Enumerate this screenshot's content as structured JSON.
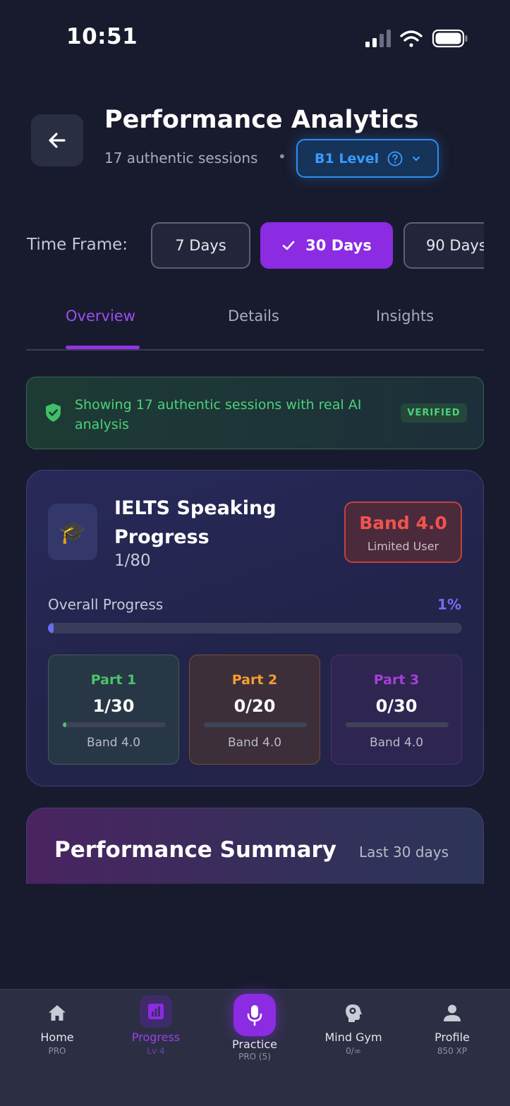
{
  "status_bar": {
    "time": "10:51"
  },
  "header": {
    "title": "Performance Analytics",
    "sessions": "17 authentic sessions",
    "separator": "•",
    "level": "B1 Level"
  },
  "time_frame": {
    "label": "Time Frame:",
    "options": [
      "7 Days",
      "30 Days",
      "90 Days"
    ],
    "selected": "30 Days"
  },
  "tabs": [
    "Overview",
    "Details",
    "Insights"
  ],
  "active_tab": "Overview",
  "verified_banner": {
    "text": "Showing 17 authentic sessions with real AI analysis",
    "badge": "VERIFIED"
  },
  "ielts": {
    "title": "IELTS Speaking Progress",
    "count": "1/80",
    "band": "Band 4.0",
    "band_desc": "Limited User",
    "overall_label": "Overall Progress",
    "overall_pct": "1%",
    "overall_fraction": 0.0125,
    "parts": [
      {
        "name": "Part 1",
        "score": "1/30",
        "band": "Band 4.0",
        "fraction": 0.0333,
        "color": "#4bc46a"
      },
      {
        "name": "Part 2",
        "score": "0/20",
        "band": "Band 4.0",
        "fraction": 0,
        "color": "#f59e2e"
      },
      {
        "name": "Part 3",
        "score": "0/30",
        "band": "Band 4.0",
        "fraction": 0,
        "color": "#a63fd8"
      }
    ]
  },
  "summary": {
    "title": "Performance Summary",
    "range": "Last 30 days"
  },
  "nav": [
    {
      "label": "Home",
      "sub": "PRO",
      "icon": "home-icon"
    },
    {
      "label": "Progress",
      "sub": "Lv 4",
      "icon": "chart-icon"
    },
    {
      "label": "Practice",
      "sub": "PRO (5)",
      "icon": "microphone-icon"
    },
    {
      "label": "Mind Gym",
      "sub": "0/∞",
      "icon": "brain-icon"
    },
    {
      "label": "Profile",
      "sub": "850 XP",
      "icon": "user-icon"
    }
  ],
  "colors": {
    "accent": "#8b2be2",
    "verified": "#4bd27a",
    "band": "#f0534f",
    "level": "#3a9bff"
  }
}
